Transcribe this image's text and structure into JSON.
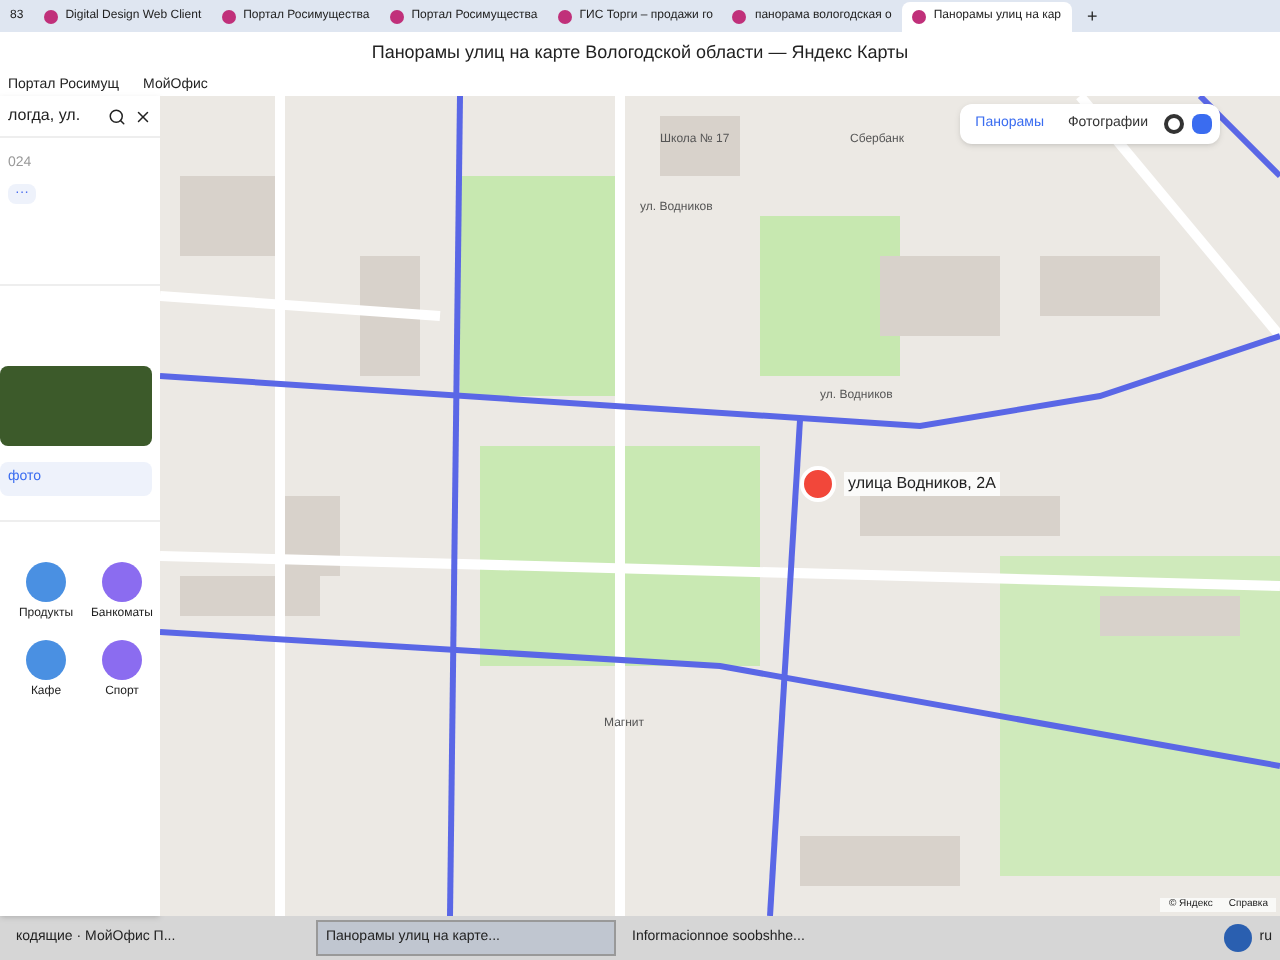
{
  "browser_tabs": [
    {
      "label": "83",
      "selected": false
    },
    {
      "label": "Digital Design Web Client",
      "selected": false
    },
    {
      "label": "Портал Росимущества",
      "selected": false
    },
    {
      "label": "Портал Росимущества",
      "selected": false
    },
    {
      "label": "ГИС Торги – продажи го",
      "selected": false
    },
    {
      "label": "панорама вологодская о",
      "selected": false
    },
    {
      "label": "Панорамы улиц на кар",
      "selected": true
    }
  ],
  "new_tab": "+",
  "window": {
    "title": "Панорамы улиц на карте Вологодской области — Яндекс Карты"
  },
  "bookmarks": [
    "Портал Росимущ",
    "МойОфис"
  ],
  "panel": {
    "search": {
      "value": "логда, ул."
    },
    "subtitle": "024",
    "more": "···",
    "photo_link": "фото",
    "categories": [
      {
        "label": "Продукты",
        "color": "#4a90e2"
      },
      {
        "label": "Банкоматы",
        "color": "#8b6cf0"
      },
      {
        "label": "Кафе",
        "color": "#4a90e2"
      },
      {
        "label": "Спорт",
        "color": "#8b6cf0"
      }
    ]
  },
  "map": {
    "layers": [
      {
        "label": "Панорамы",
        "selected": true
      },
      {
        "label": "Фотографии",
        "selected": false
      }
    ],
    "labels": [
      "Школа № 17",
      "Сбербанк",
      "ул. Водников",
      "ул. Водников",
      "Магнит"
    ],
    "marker": "улица Водников, 2А",
    "attribution": [
      "© Яндекс",
      "Справка"
    ]
  },
  "taskbar": {
    "items": [
      {
        "label": "кодящие · МойОфис П...",
        "selected": false
      },
      {
        "label": "Панорамы улиц на карте...",
        "selected": true
      },
      {
        "label": "Informacionnoe soobshhe...",
        "selected": false
      }
    ],
    "lang": "ru"
  }
}
